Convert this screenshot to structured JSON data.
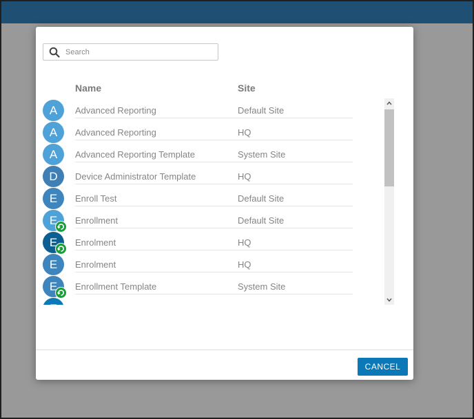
{
  "search": {
    "placeholder": "Search",
    "value": ""
  },
  "table": {
    "headers": {
      "name": "Name",
      "site": "Site"
    },
    "rows": [
      {
        "initial": "A",
        "name": "Advanced Reporting",
        "site": "Default Site",
        "avatar_color": "#4fa2d8",
        "sync": false
      },
      {
        "initial": "A",
        "name": "Advanced Reporting",
        "site": "HQ",
        "avatar_color": "#4fa2d8",
        "sync": false
      },
      {
        "initial": "A",
        "name": "Advanced Reporting Template",
        "site": "System Site",
        "avatar_color": "#4fa2d8",
        "sync": false
      },
      {
        "initial": "D",
        "name": "Device Administrator Template",
        "site": "HQ",
        "avatar_color": "#3f7fb3",
        "sync": false
      },
      {
        "initial": "E",
        "name": "Enroll Test",
        "site": "Default Site",
        "avatar_color": "#3e84bd",
        "sync": false
      },
      {
        "initial": "E",
        "name": "Enrollment",
        "site": "Default Site",
        "avatar_color": "#4fa2d8",
        "sync": true
      },
      {
        "initial": "E",
        "name": "Enrolment",
        "site": "HQ",
        "avatar_color": "#0d5f91",
        "sync": true
      },
      {
        "initial": "E",
        "name": "Enrolment",
        "site": "HQ",
        "avatar_color": "#3e84bd",
        "sync": false
      },
      {
        "initial": "E",
        "name": "Enrollment Template",
        "site": "System Site",
        "avatar_color": "#3e84bd",
        "sync": true
      },
      {
        "initial": "E",
        "name": "",
        "site": "",
        "avatar_color": "#0b79b8",
        "sync": false
      }
    ]
  },
  "footer": {
    "cancel_label": "CANCEL"
  },
  "colors": {
    "topbar": "#1f4f72",
    "accent": "#0b79b8",
    "sync_badge": "#1a9e3c"
  }
}
